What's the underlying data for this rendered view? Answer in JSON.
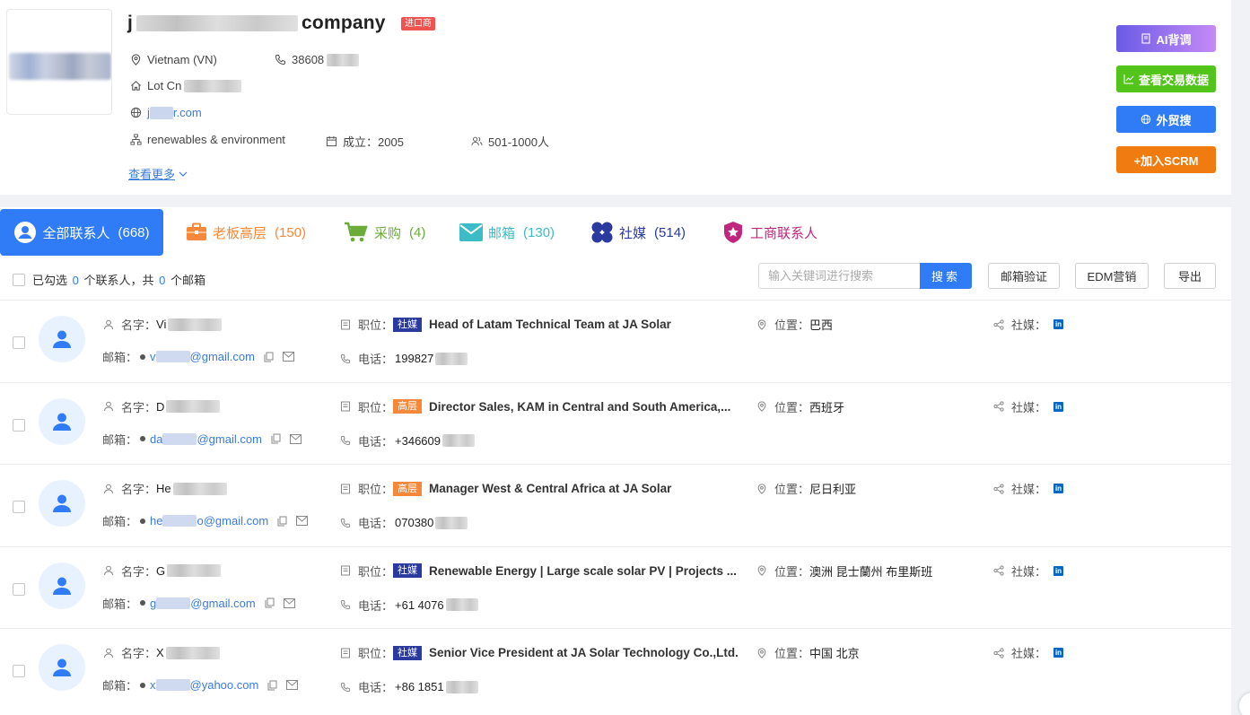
{
  "company": {
    "name_visible": "company",
    "badge": "进口商",
    "country": "Vietnam (VN)",
    "phone": "38608",
    "address": "Lot Cn",
    "website_prefix": "j",
    "website_suffix": "r.com",
    "industry": "renewables & environment",
    "founded": "成立：2005",
    "employees": "501-1000人",
    "more_link": "查看更多"
  },
  "side_buttons": {
    "ai": "AI背调",
    "trade": "查看交易数据",
    "foreign": "外贸搜",
    "scrm": "+加入SCRM"
  },
  "tabs": [
    {
      "label": "全部联系人",
      "count": "(668)",
      "color": "#ffffff",
      "icon": "user-circle-icon"
    },
    {
      "label": "老板高层",
      "count": "(150)",
      "color": "#f5883a",
      "icon": "briefcase-icon"
    },
    {
      "label": "采购",
      "count": "(4)",
      "color": "#6aab3a",
      "icon": "cart-icon"
    },
    {
      "label": "邮箱",
      "count": "(130)",
      "color": "#3bbcc6",
      "icon": "mail-icon"
    },
    {
      "label": "社媒",
      "count": "(514)",
      "color": "#2b3a9e",
      "icon": "clover-icon"
    },
    {
      "label": "工商联系人",
      "count": "",
      "color": "#c0267d",
      "icon": "badge-star-icon"
    }
  ],
  "toolbar": {
    "selected_prefix": "已勾选",
    "selected_count": "0",
    "selected_mid": "个联系人，共",
    "email_count": "0",
    "selected_suffix": "个邮箱",
    "search_placeholder": "输入关键词进行搜索",
    "search_btn": "搜索",
    "verify_btn": "邮箱验证",
    "edm_btn": "EDM营销",
    "export_btn": "导出"
  },
  "labels": {
    "name": "名字：",
    "email": "邮箱：",
    "job": "职位：",
    "phone": "电话：",
    "location": "位置：",
    "social": "社媒："
  },
  "contacts": [
    {
      "name": "Vi",
      "email_prefix": "v",
      "email_domain": "@gmail.com",
      "tag": "社媒",
      "tag_type": "social",
      "title": "Head of Latam Technical Team at JA Solar",
      "phone": "199827",
      "location": "巴西"
    },
    {
      "name": "D",
      "email_prefix": "da",
      "email_domain": "@gmail.com",
      "tag": "高层",
      "tag_type": "senior",
      "title": "Director Sales, KAM in Central and South America,...",
      "phone": "+346609",
      "location": "西班牙"
    },
    {
      "name": "He",
      "email_prefix": "he",
      "email_domain": "o@gmail.com",
      "tag": "高层",
      "tag_type": "senior",
      "title": "Manager West & Central Africa at JA Solar",
      "phone": "070380",
      "location": "尼日利亚"
    },
    {
      "name": "G",
      "email_prefix": "g",
      "email_domain": "@gmail.com",
      "tag": "社媒",
      "tag_type": "social",
      "title": "Renewable Energy | Large scale solar PV | Projects ...",
      "phone": "+61 4076",
      "location": "澳洲 昆士蘭州 布里斯班"
    },
    {
      "name": "X",
      "email_prefix": "x",
      "email_domain": "@yahoo.com",
      "tag": "社媒",
      "tag_type": "social",
      "title": "Senior Vice President at JA Solar Technology Co.,Ltd.",
      "phone": "+86 1851",
      "location": "中国 北京"
    }
  ]
}
